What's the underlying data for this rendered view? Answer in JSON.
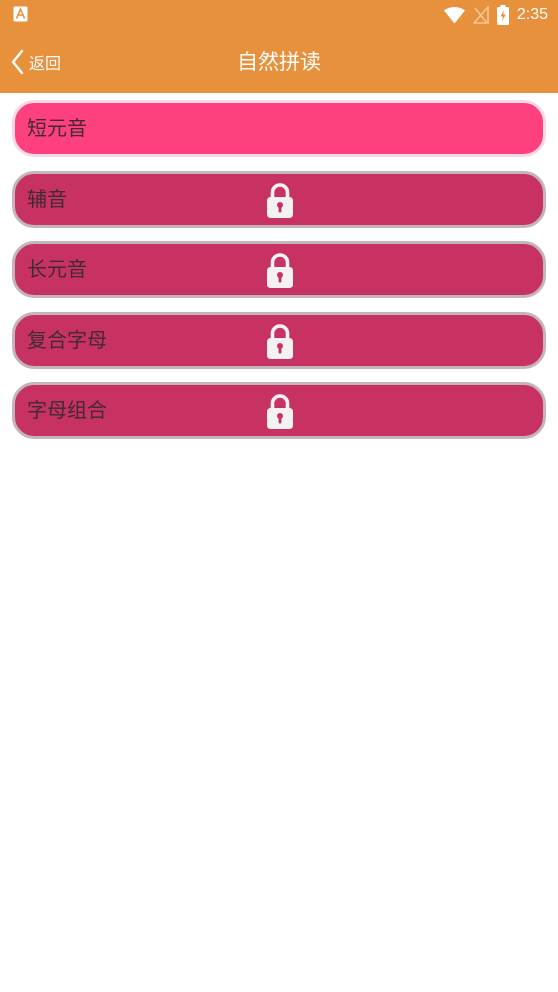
{
  "status_bar": {
    "notification_icon": "app-notification-icon",
    "wifi_icon": "wifi-icon",
    "signal_icon": "no-signal-icon",
    "battery_icon": "battery-charging-icon",
    "time": "2:35"
  },
  "nav": {
    "back_icon": "chevron-left-icon",
    "back_label": "返回",
    "title": "自然拼读"
  },
  "lessons": [
    {
      "label": "短元音",
      "locked": false
    },
    {
      "label": "辅音",
      "locked": true
    },
    {
      "label": "长元音",
      "locked": true
    },
    {
      "label": "复合字母",
      "locked": true
    },
    {
      "label": "字母组合",
      "locked": true
    }
  ],
  "colors": {
    "header_bg": "#E8913C",
    "active_item_bg": "#FF407E",
    "locked_item_bg": "#C83262",
    "lock_icon": "#f4f1f3"
  }
}
